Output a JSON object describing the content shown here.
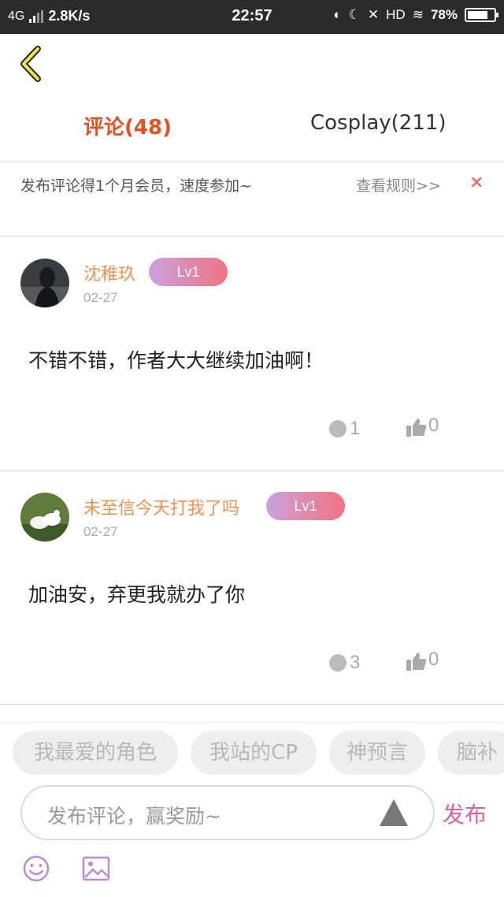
{
  "status_bar": {
    "network": "4G",
    "speed": "2.8K/s",
    "time": "22:57",
    "hd": "HD",
    "battery": "78%",
    "battery_level": 0.78
  },
  "tabs": [
    {
      "label": "评论(48)",
      "active": true
    },
    {
      "label": "Cosplay(211)",
      "active": false
    }
  ],
  "promo": {
    "text": "发布评论得1个月会员，速度参加~",
    "rules_link": "查看规则>>",
    "close": "×"
  },
  "comments": [
    {
      "username": "沈稚玖",
      "level": "Lv1",
      "date": "02-27",
      "text": "不错不错，作者大大继续加油啊！",
      "replies": "1",
      "likes": "0"
    },
    {
      "username": "未至信今天打我了吗",
      "level": "Lv1",
      "date": "02-27",
      "text": "加油安，弃更我就办了你",
      "replies": "3",
      "likes": "0"
    }
  ],
  "quick_tags": [
    "我最爱的角色",
    "我站的CP",
    "神预言",
    "脑补"
  ],
  "input": {
    "placeholder": "发布评论，赢奖励~",
    "publish_label": "发布"
  },
  "colors": {
    "accent_tab": "#e4501f",
    "username": "#f0914d",
    "publish": "#e0609a",
    "level_gradient_start": "#c9a2df",
    "level_gradient_end": "#f2737f"
  }
}
